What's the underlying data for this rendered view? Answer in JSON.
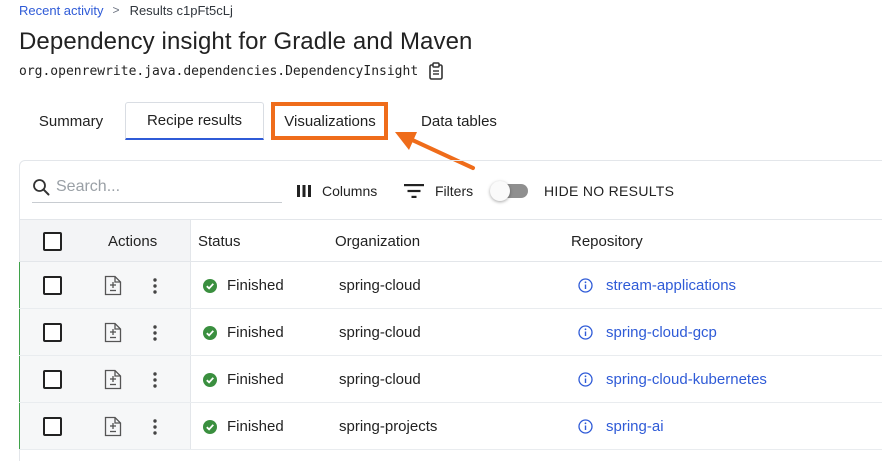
{
  "breadcrumb": {
    "link": "Recent activity",
    "separator": ">",
    "current": "Results c1pFt5cLj"
  },
  "page": {
    "title": "Dependency insight for Gradle and Maven",
    "recipe_id": "org.openrewrite.java.dependencies.DependencyInsight"
  },
  "tabs": [
    {
      "label": "Summary"
    },
    {
      "label": "Recipe results"
    },
    {
      "label": "Visualizations"
    },
    {
      "label": "Data tables"
    }
  ],
  "active_tab": "Recipe results",
  "highlighted_tab": "Visualizations",
  "colors": {
    "accent": "#2f5bd7",
    "highlight": "#ef6c1a",
    "success": "#3fa24a"
  },
  "toolbar": {
    "search_placeholder": "Search...",
    "columns_label": "Columns",
    "filters_label": "Filters",
    "toggle_label": "HIDE NO RESULTS",
    "toggle_on": false
  },
  "table": {
    "headers": {
      "actions": "Actions",
      "status": "Status",
      "organization": "Organization",
      "repository": "Repository"
    },
    "rows": [
      {
        "status": "Finished",
        "organization": "spring-cloud",
        "repository": "stream-applications"
      },
      {
        "status": "Finished",
        "organization": "spring-cloud",
        "repository": "spring-cloud-gcp"
      },
      {
        "status": "Finished",
        "organization": "spring-cloud",
        "repository": "spring-cloud-kubernetes"
      },
      {
        "status": "Finished",
        "organization": "spring-projects",
        "repository": "spring-ai"
      }
    ]
  },
  "icons": [
    "copy-icon",
    "search-icon",
    "columns-icon",
    "filter-icon",
    "diff-icon",
    "kebab-icon",
    "check-circle-icon",
    "info-icon",
    "arrow-icon"
  ]
}
